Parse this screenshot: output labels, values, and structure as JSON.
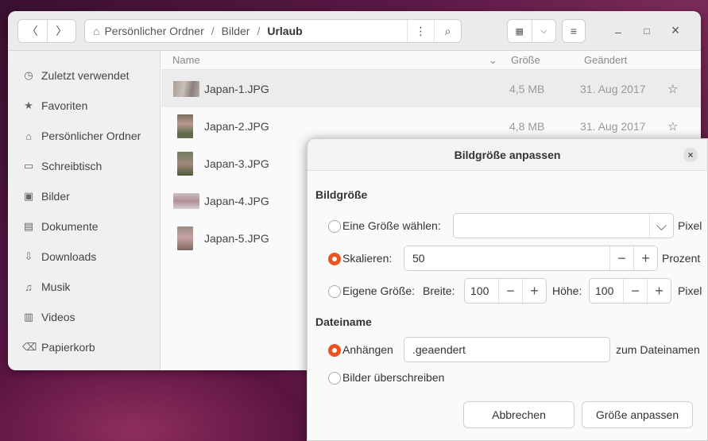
{
  "filemanager": {
    "breadcrumb": [
      "Persönlicher Ordner",
      "Bilder",
      "Urlaub"
    ],
    "breadcrumb_sep": "/",
    "more_icon": "⋮",
    "search_icon": "⌕",
    "view_icon": "▦",
    "view_dropdown_icon": "⌵",
    "menu_icon": "≡",
    "window_controls": {
      "minimize": "–",
      "maximize": "□",
      "close": "×"
    },
    "sidebar": [
      {
        "icon": "clock-icon",
        "glyph": "◷",
        "label": "Zuletzt verwendet"
      },
      {
        "icon": "star-icon",
        "glyph": "★",
        "label": "Favoriten"
      },
      {
        "icon": "home-icon",
        "glyph": "⌂",
        "label": "Persönlicher Ordner"
      },
      {
        "icon": "desktop-icon",
        "glyph": "▭",
        "label": "Schreibtisch"
      },
      {
        "icon": "pictures-icon",
        "glyph": "▣",
        "label": "Bilder"
      },
      {
        "icon": "document-icon",
        "glyph": "▤",
        "label": "Dokumente"
      },
      {
        "icon": "download-icon",
        "glyph": "⇩",
        "label": "Downloads"
      },
      {
        "icon": "music-icon",
        "glyph": "♫",
        "label": "Musik"
      },
      {
        "icon": "video-icon",
        "glyph": "▥",
        "label": "Videos"
      },
      {
        "icon": "trash-icon",
        "glyph": "⌫",
        "label": "Papierkorb"
      }
    ],
    "columns": {
      "name": "Name",
      "size": "Größe",
      "modified": "Geändert",
      "sort_icon": "⌄"
    },
    "files": [
      {
        "name": "Japan-1.JPG",
        "size": "4,5 MB",
        "date": "31. Aug 2017",
        "star": "☆"
      },
      {
        "name": "Japan-2.JPG",
        "size": "4,8 MB",
        "date": "31. Aug 2017",
        "star": "☆"
      },
      {
        "name": "Japan-3.JPG",
        "size": "",
        "date": "",
        "star": ""
      },
      {
        "name": "Japan-4.JPG",
        "size": "",
        "date": "",
        "star": ""
      },
      {
        "name": "Japan-5.JPG",
        "size": "",
        "date": "",
        "star": ""
      }
    ]
  },
  "dialog": {
    "title": "Bildgröße anpassen",
    "close": "×",
    "section_size": "Bildgröße",
    "opt_choose": "Eine Größe wählen:",
    "choose_value": "",
    "choose_unit": "Pixel",
    "opt_scale": "Skalieren:",
    "scale_value": "50",
    "scale_unit": "Prozent",
    "opt_custom": "Eigene Größe:",
    "width_label": "Breite:",
    "width_value": "100",
    "height_label": "Höhe:",
    "height_value": "100",
    "custom_unit": "Pixel",
    "minus": "−",
    "plus": "+",
    "dropdown": "⌵",
    "section_filename": "Dateiname",
    "opt_append": "Anhängen",
    "append_value": ".geaendert",
    "append_suffix": "zum Dateinamen",
    "opt_overwrite": "Bilder überschreiben",
    "cancel": "Abbrechen",
    "apply": "Größe anpassen"
  }
}
